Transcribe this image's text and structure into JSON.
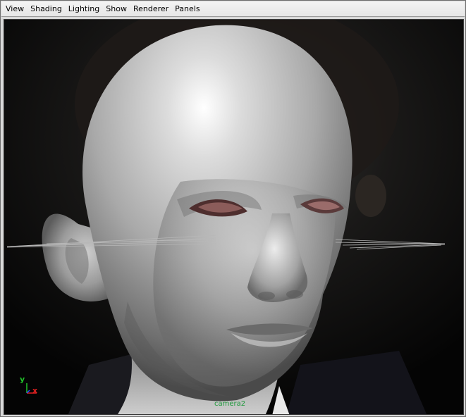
{
  "menubar": {
    "items": [
      "View",
      "Shading",
      "Lighting",
      "Show",
      "Renderer",
      "Panels"
    ]
  },
  "viewport": {
    "camera_label": "camera2",
    "axis": {
      "y": "y",
      "x": "x"
    }
  },
  "colors": {
    "menu_bg": "#ececec",
    "viewport_bg": "#050505",
    "camera_label": "#1f9a3c",
    "axis_y": "#22c12a",
    "axis_x": "#e02020",
    "axis_z": "#2a4cff"
  },
  "icons": {
    "axis_gizmo": "xyz-axis-icon"
  }
}
